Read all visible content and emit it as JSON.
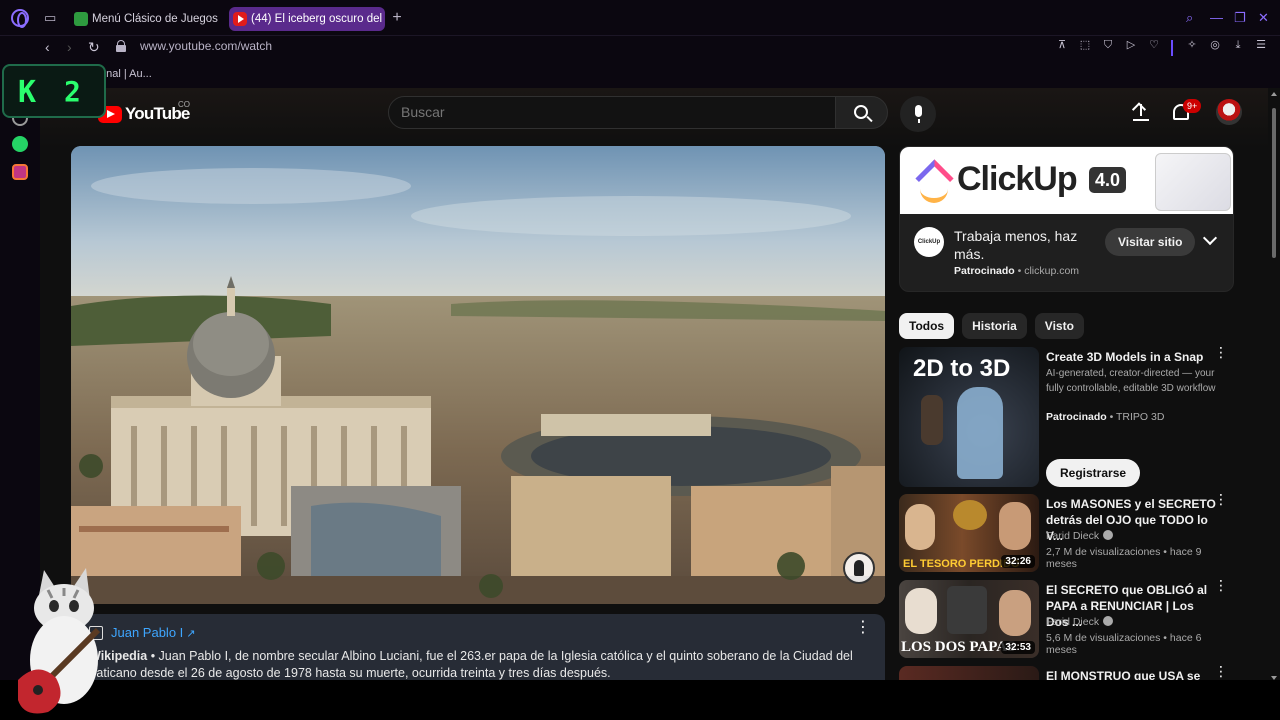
{
  "browser": {
    "tabs": [
      {
        "label": "Menú Clásico de Juegos F",
        "active": false
      },
      {
        "label": "(44) El iceberg oscuro del",
        "active": true
      }
    ],
    "url": "www.youtube.com/watch",
    "bookmark_text": "onal | Au..."
  },
  "overlay": {
    "k2_letter": "K",
    "k2_number": "2"
  },
  "youtube": {
    "logo_text": "YouTube",
    "country_code": "CO",
    "search_placeholder": "Buscar",
    "notification_count": "9+"
  },
  "info_panel": {
    "title": "Juan Pablo I",
    "source": "Wikipedia",
    "text": " • Juan Pablo I, de nombre secular Albino Luciani, fue el 263.er papa de la Iglesia católica y el quinto soberano de la Ciudad del Vaticano desde el 26 de agosto de 1978 hasta su muerte, ocurrida treinta y tres días después."
  },
  "ad": {
    "brand": "ClickUp",
    "version": "4.0",
    "avatar_text": "ClickUp",
    "headline": "Trabaja menos, haz más.",
    "sponsored_label": "Patrocinado",
    "domain": "clickup.com",
    "cta": "Visitar sitio"
  },
  "chips": [
    "Todos",
    "Historia",
    "Visto"
  ],
  "recommendations": [
    {
      "title": "Create 3D Models in a Snap",
      "description": "AI-generated, creator-directed — your fully controllable, editable 3D workflow",
      "sponsored_label": "Patrocinado",
      "channel": "TRIPO 3D",
      "cta": "Registrarse",
      "thumb_text": "2D to 3D"
    },
    {
      "title": "Los MASONES y el SECRETO detrás del OJO que TODO lo V...",
      "channel": "Farid Dieck",
      "meta": "2,7 M de visualizaciones • hace 9 meses",
      "duration": "32:26",
      "thumb_text": "EL TESORO PERDIDO"
    },
    {
      "title": "El SECRETO que OBLIGÓ al PAPA a RENUNCIAR | Los Dos ...",
      "channel": "Farid Dieck",
      "meta": "5,6 M de visualizaciones • hace 6 meses",
      "duration": "32:53",
      "thumb_text": "LOS DOS PAPAS"
    },
    {
      "title": "El MONSTRUO que USA se"
    }
  ],
  "icons": {
    "search": "search-icon",
    "mic": "microphone-icon",
    "upload": "upload-icon",
    "bell": "bell-icon"
  }
}
